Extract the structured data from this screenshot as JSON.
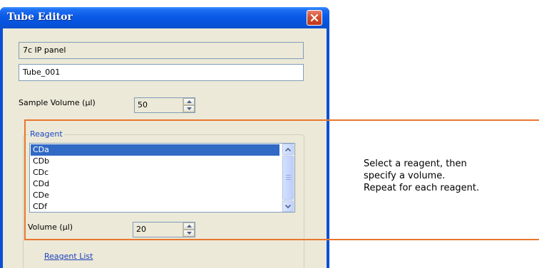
{
  "window": {
    "title": "Tube Editor"
  },
  "fields": {
    "panel_name": "7c IP panel",
    "tube_name": "Tube_001"
  },
  "sample_volume": {
    "label": "Sample Volume (µl)",
    "value": "50"
  },
  "reagent_group": {
    "title": "Reagent",
    "items": [
      {
        "label": "CDa",
        "selected": true
      },
      {
        "label": "CDb",
        "selected": false
      },
      {
        "label": "CDc",
        "selected": false
      },
      {
        "label": "CDd",
        "selected": false
      },
      {
        "label": "CDe",
        "selected": false
      },
      {
        "label": "CDf",
        "selected": false
      }
    ],
    "volume_label": "Volume (µl)",
    "volume_value": "20",
    "link_label": "Reagent List"
  },
  "callout": {
    "lines": [
      "Select a reagent, then",
      "specify a volume.",
      "Repeat for each reagent."
    ]
  },
  "colors": {
    "title_bar": "#0654dc",
    "selection": "#316ac5",
    "callout_border": "#e8772e",
    "client_bg": "#ece9d8"
  },
  "icons": {
    "close": "close-icon",
    "spin_up": "arrow-up-icon",
    "spin_down": "arrow-down-icon",
    "scroll_up": "scroll-up-icon",
    "scroll_down": "scroll-down-icon"
  }
}
